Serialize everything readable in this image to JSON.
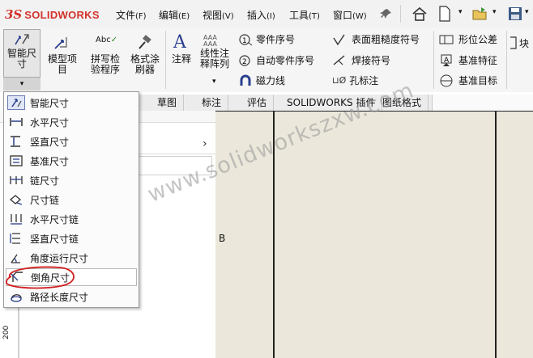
{
  "brand": {
    "ds": "3S",
    "name": "SOLIDWORKS"
  },
  "menu": [
    {
      "label": "文件",
      "key": "(F)"
    },
    {
      "label": "编辑",
      "key": "(E)"
    },
    {
      "label": "视图",
      "key": "(V)"
    },
    {
      "label": "插入",
      "key": "(I)"
    },
    {
      "label": "工具",
      "key": "(T)"
    },
    {
      "label": "窗口",
      "key": "(W)"
    }
  ],
  "ribbon": {
    "smart_dim": {
      "line1": "智能尺",
      "line2": "寸"
    },
    "model_items": {
      "line1": "模型项",
      "line2": "目"
    },
    "spell": {
      "line1": "拼写检",
      "line2": "验程序"
    },
    "format_painter": {
      "line1": "格式涂",
      "line2": "刷器"
    },
    "note": {
      "label": "注释"
    },
    "linear_pattern": {
      "line1": "线性注",
      "line2": "释阵列"
    },
    "balloon": "零件序号",
    "auto_balloon": "自动零件序号",
    "magnetic_line": "磁力线",
    "surface_finish": "表面粗糙度符号",
    "weld_symbol": "焊接符号",
    "hole_callout": "孔标注",
    "gtol": "形位公差",
    "datum_feature": "基准特征",
    "datum_target": "基准目标",
    "block": "块"
  },
  "tabs": [
    "草图",
    "标注",
    "评估",
    "SOLIDWORKS 插件",
    "图纸格式"
  ],
  "dropdown": [
    {
      "label": "智能尺寸",
      "icon": "smart-dimension-icon"
    },
    {
      "label": "水平尺寸",
      "icon": "horizontal-dimension-icon"
    },
    {
      "label": "竖直尺寸",
      "icon": "vertical-dimension-icon"
    },
    {
      "label": "基准尺寸",
      "icon": "baseline-dimension-icon"
    },
    {
      "label": "链尺寸",
      "icon": "chain-dimension-icon"
    },
    {
      "label": "尺寸链",
      "icon": "ordinate-dimension-icon"
    },
    {
      "label": "水平尺寸链",
      "icon": "horizontal-ordinate-icon"
    },
    {
      "label": "竖直尺寸链",
      "icon": "vertical-ordinate-icon"
    },
    {
      "label": "角度运行尺寸",
      "icon": "angular-running-icon"
    },
    {
      "label": "倒角尺寸",
      "icon": "chamfer-dimension-icon"
    },
    {
      "label": "路径长度尺寸",
      "icon": "path-length-icon"
    }
  ],
  "drawing": {
    "border_letter": "B",
    "ruler_value": "200"
  },
  "watermark": "www.solidworkszxw.com"
}
